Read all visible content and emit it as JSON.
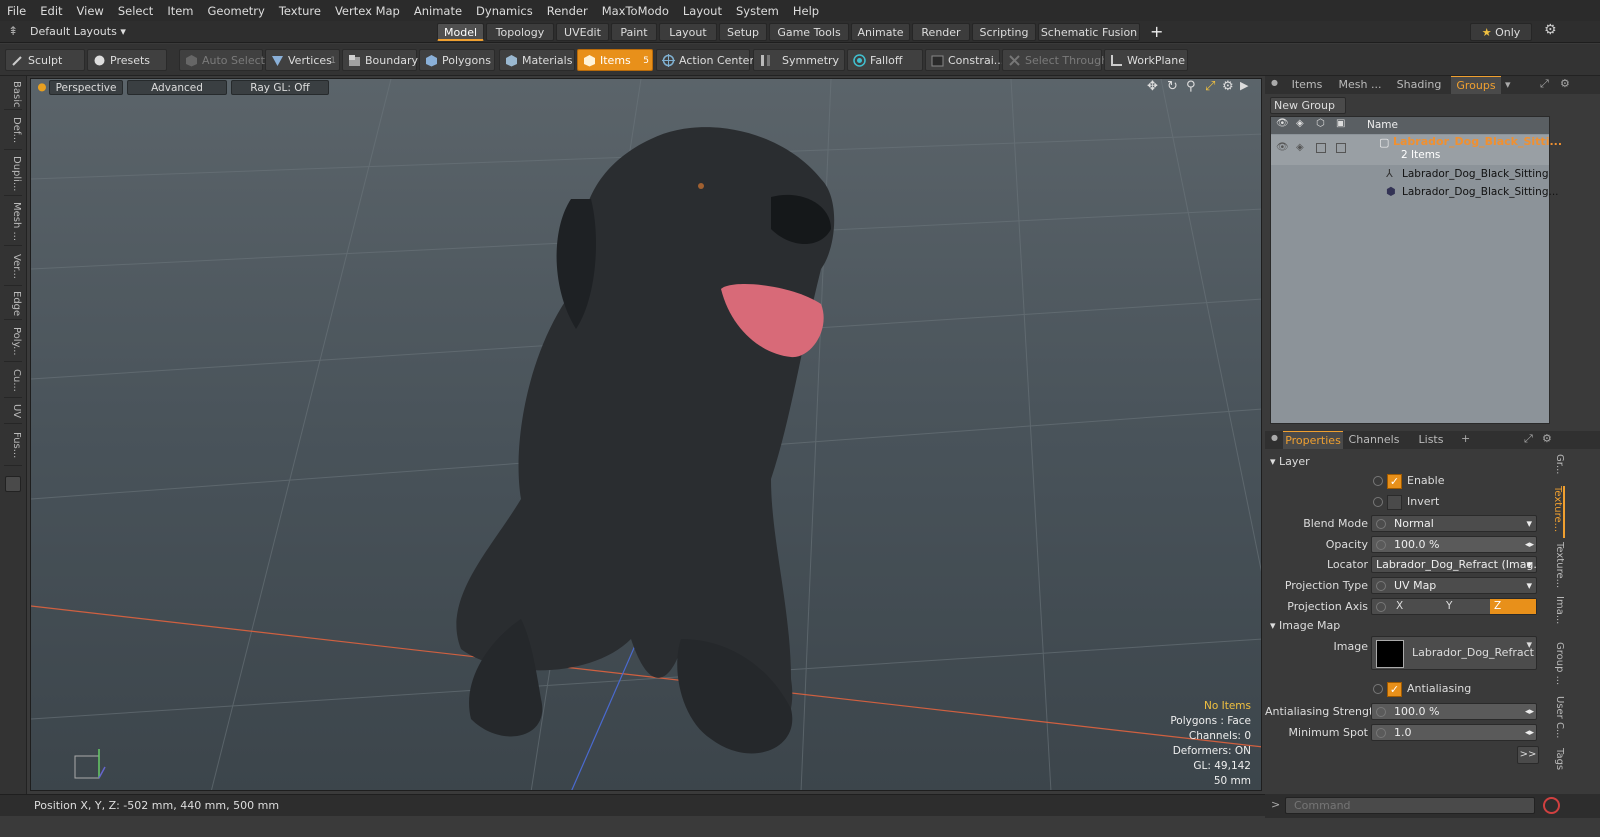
{
  "menu": [
    "File",
    "Edit",
    "View",
    "Select",
    "Item",
    "Geometry",
    "Texture",
    "Vertex Map",
    "Animate",
    "Dynamics",
    "Render",
    "MaxToModo",
    "Layout",
    "System",
    "Help"
  ],
  "layout_selector": "Default Layouts",
  "layout_tabs": [
    "Model",
    "Topology",
    "UVEdit",
    "Paint",
    "Layout",
    "Setup",
    "Game Tools",
    "Animate",
    "Render",
    "Scripting",
    "Schematic Fusion"
  ],
  "only_label": "Only",
  "toolbar": {
    "sculpt": "Sculpt",
    "presets": "Presets",
    "auto_select": "Auto Select",
    "vertices": "Vertices",
    "vertices_count": "1",
    "boundary": "Boundary",
    "polygons": "Polygons",
    "materials": "Materials",
    "items": "Items",
    "items_count": "5",
    "action_center": "Action Center",
    "symmetry": "Symmetry",
    "falloff": "Falloff",
    "constraints": "Constrai...",
    "select_through": "Select Through",
    "workplane": "WorkPlane"
  },
  "left_tabs": [
    "Basic",
    "Def...",
    "Dupli...",
    "Mesh ...",
    "Ver...",
    "Edge",
    "Poly...",
    "Cu...",
    "UV",
    "Fus..."
  ],
  "viewport": {
    "view": "Perspective",
    "advanced": "Advanced",
    "raygl": "Ray GL: Off",
    "info": {
      "no_items": "No Items",
      "polygons": "Polygons : Face",
      "channels": "Channels: 0",
      "deformers": "Deformers: ON",
      "gl": "GL: 49,142",
      "scale": "50 mm"
    }
  },
  "status": {
    "position": "Position X, Y, Z:  -502 mm, 440 mm, 500 mm"
  },
  "items_panel": {
    "tabs": [
      "Items",
      "Mesh ...",
      "Shading",
      "Groups"
    ],
    "new_group": "New Group",
    "name_header": "Name",
    "group_name": "Labrador_Dog_Black_Sitti...",
    "group_count": "2 Items",
    "children": [
      "Labrador_Dog_Black_Sitting",
      "Labrador_Dog_Black_Sitting..."
    ]
  },
  "properties": {
    "tabs": [
      "Properties",
      "Channels",
      "Lists"
    ],
    "layer_section": "Layer",
    "enable": "Enable",
    "invert": "Invert",
    "blend_mode_label": "Blend Mode",
    "blend_mode": "Normal",
    "opacity_label": "Opacity",
    "opacity": "100.0 %",
    "locator_label": "Locator",
    "locator": "Labrador_Dog_Refract (Imag...",
    "projection_type_label": "Projection Type",
    "projection_type": "UV Map",
    "projection_axis_label": "Projection Axis",
    "axis_x": "X",
    "axis_y": "Y",
    "axis_z": "Z",
    "image_map_section": "Image Map",
    "image_label": "Image",
    "image": "Labrador_Dog_Refract",
    "antialiasing": "Antialiasing",
    "aa_strength_label": "Antialiasing Strength",
    "aa_strength": "100.0 %",
    "min_spot_label": "Minimum Spot",
    "min_spot": "1.0",
    "more": ">>"
  },
  "side_tabs": [
    "Gr...",
    "Texture...",
    "Texture...",
    "Ima...",
    "Group ...",
    "User C...",
    "Tags"
  ],
  "command_placeholder": "Command",
  "colors": {
    "accent": "#e8901a",
    "viewport_bg": "#4f585e"
  }
}
